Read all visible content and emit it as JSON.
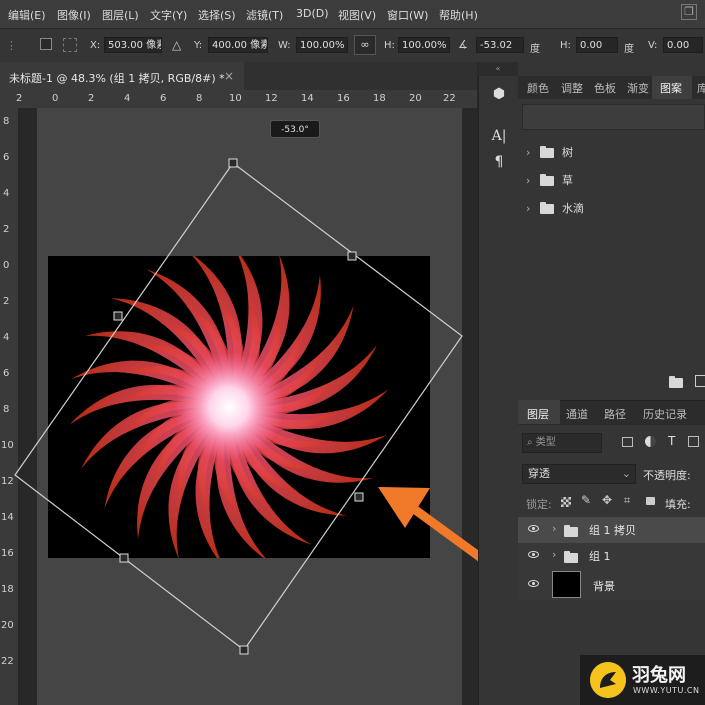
{
  "menu": [
    "编辑(E)",
    "图像(I)",
    "图层(L)",
    "文字(Y)",
    "选择(S)",
    "滤镜(T)",
    "3D(D)",
    "视图(V)",
    "窗口(W)",
    "帮助(H)"
  ],
  "options_bar": {
    "x_label": "X:",
    "x_value": "503.00 像素",
    "y_label": "Y:",
    "y_value": "400.00 像素",
    "w_label": "W:",
    "w_value": "100.00%",
    "h_label": "H:",
    "h_value": "100.00%",
    "angle_value": "-53.02",
    "angle_unit": "度",
    "hskew_label": "H:",
    "hskew_value": "0.00",
    "hskew_unit": "度",
    "vskew_label": "V:",
    "vskew_value": "0.00"
  },
  "document": {
    "tab_title": "未标题-1 @ 48.3% (组 1 拷贝, RGB/8#) *",
    "close_symbol": "×",
    "angle_tooltip": "-53.0°"
  },
  "ruler_top": [
    "2",
    "0",
    "2",
    "4",
    "6",
    "8",
    "10",
    "12",
    "14",
    "16",
    "18",
    "20",
    "22"
  ],
  "ruler_left": [
    "8",
    "6",
    "4",
    "2",
    "0",
    "2",
    "4",
    "6",
    "8",
    "10",
    "12",
    "14",
    "16",
    "18",
    "20",
    "22"
  ],
  "mini_toolbar": {
    "collapse": "«",
    "tools": [
      "3d-cube-icon",
      "character-icon",
      "paragraph-icon"
    ]
  },
  "panel_tabs": [
    "颜色",
    "调整",
    "色板",
    "渐变",
    "图案",
    "库"
  ],
  "patterns": [
    "树",
    "草",
    "水滴"
  ],
  "layers_panel": {
    "tabs": [
      "图层",
      "通道",
      "路径",
      "历史记录"
    ],
    "filter_placeholder": "类型",
    "blend_mode": "穿透",
    "opacity_label": "不透明度:",
    "lock_label": "锁定:",
    "fill_label": "填充:",
    "layers": [
      {
        "name": "组 1 拷贝",
        "type": "group",
        "selected": true
      },
      {
        "name": "组 1",
        "type": "group",
        "selected": false
      },
      {
        "name": "背景",
        "type": "background",
        "selected": false
      }
    ]
  },
  "watermark": {
    "title": "羽兔网",
    "url": "WWW.YUTU.CN"
  },
  "colors": {
    "arrow": "#f07a2a",
    "accent": "#f4c31c"
  }
}
